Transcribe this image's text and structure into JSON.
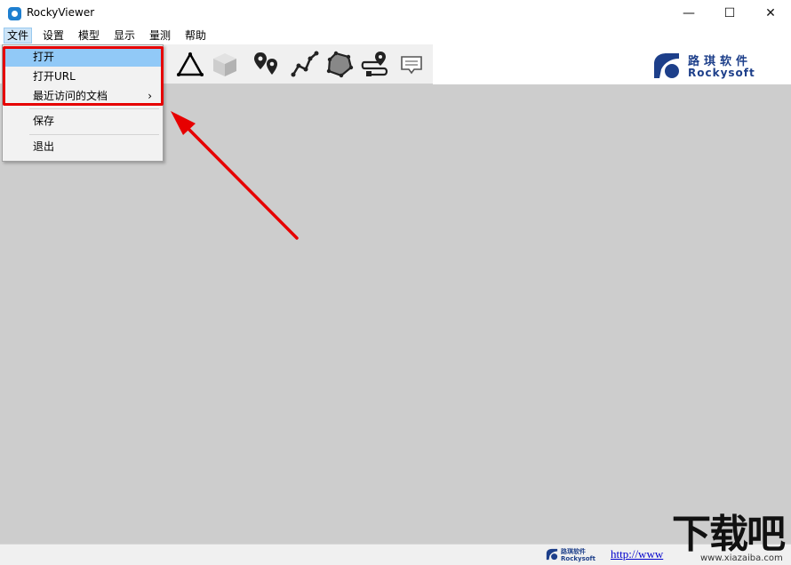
{
  "window": {
    "title": "RockyViewer",
    "minimize_glyph": "—",
    "maximize_glyph": "☐",
    "close_glyph": "✕"
  },
  "menubar": {
    "items": [
      {
        "label": "文件",
        "active": true
      },
      {
        "label": "设置"
      },
      {
        "label": "模型"
      },
      {
        "label": "显示"
      },
      {
        "label": "量测"
      },
      {
        "label": "帮助"
      }
    ]
  },
  "file_menu": {
    "items": [
      {
        "label": "打开",
        "highlighted": true
      },
      {
        "label": "打开URL"
      },
      {
        "label": "最近访问的文档",
        "submenu": true
      },
      {
        "label": "保存"
      },
      {
        "label": "退出"
      }
    ],
    "submenu_glyph": "›"
  },
  "toolbar": {
    "icons": [
      "triangle-icon",
      "cube-icon",
      "place-marker-icon",
      "polyline-icon",
      "polygon-icon",
      "route-icon",
      "comment-icon"
    ]
  },
  "logo": {
    "chinese": "路琪软件",
    "english": "Rockysoft"
  },
  "statusbar": {
    "logo_chinese": "路琪软件",
    "logo_english": "Rockysoft",
    "link_text": "http://www"
  },
  "watermark": {
    "text": "下载吧",
    "url": "www.xiazaiba.com"
  },
  "colors": {
    "annotation_red": "#e60000",
    "viewport_bg": "#cdcdcd",
    "brand_blue": "#1d3f8a",
    "menu_highlight": "#91c9f7"
  }
}
